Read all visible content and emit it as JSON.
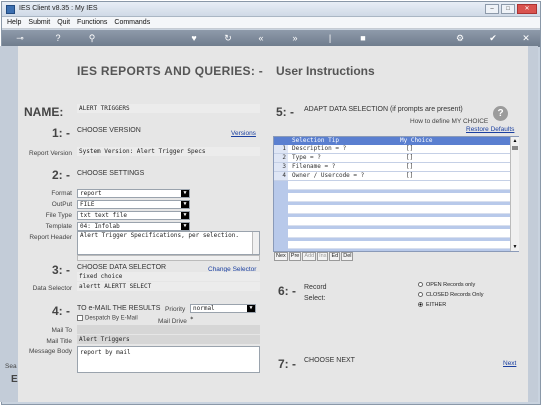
{
  "window": {
    "title": "IES Client v8.35 : My IES"
  },
  "menu": [
    "Help",
    "Submit",
    "Quit",
    "Functions",
    "Commands"
  ],
  "header": {
    "title": "IES REPORTS AND QUERIES:  -",
    "subtitle": "User Instructions"
  },
  "name": {
    "label": "NAME:",
    "value": "ALERT TRIGGERS"
  },
  "step1": {
    "number": "1: -",
    "title": "CHOOSE VERSION",
    "link": "Versions",
    "report_version_label": "Report Version",
    "report_version_value": "System Version: Alert Trigger Specs"
  },
  "step2": {
    "number": "2: -",
    "title": "CHOOSE SETTINGS",
    "format_label": "Format",
    "format_value": "report",
    "output_label": "OutPut",
    "output_value": "FILE",
    "filetype_label": "File Type",
    "filetype_value": "txt text file",
    "template_label": "Template",
    "template_value": "04: Infolab",
    "report_header_label": "Report Header",
    "report_header_value": "Alert Trigger Specifications, per selection."
  },
  "step3": {
    "number": "3: -",
    "title": "CHOOSE DATA SELECTOR",
    "link": "Change Selector",
    "line1": "fixed choice",
    "data_selector_label": "Data Selector",
    "data_selector_value": "alertt ALERTT SELECT"
  },
  "step4": {
    "number": "4: -",
    "title": "TO e-MAIL THE RESULTS",
    "priority_label": "Priority",
    "priority_value": "normal",
    "despatch_label": "Despatch By E-Mail",
    "mail_drive_label": "Mail Drive",
    "mail_drive_value": "*",
    "mail_to_label": "Mail To",
    "mail_title_label": "Mail Title",
    "mail_title_value": "Alert Triggers",
    "message_body_label": "Message Body",
    "message_body_value": "report by mail"
  },
  "step5": {
    "number": "5: -",
    "title": "ADAPT DATA SELECTION (if prompts are present)",
    "help_text": "How to define MY CHOICE",
    "restore_link": "Restore Defaults",
    "col_tip": "Selection Tip",
    "col_choice": "My Choice",
    "rows": [
      {
        "num": "1",
        "tip": "Description = ?",
        "choice": "[]"
      },
      {
        "num": "2",
        "tip": "Type = ?",
        "choice": "[]"
      },
      {
        "num": "3",
        "tip": "Filename = ?",
        "choice": "[]"
      },
      {
        "num": "4",
        "tip": "Owner / Usercode = ?",
        "choice": "[]"
      }
    ],
    "grid_buttons": [
      "Nex",
      "Pre",
      "Add",
      "Ins",
      "Ed",
      "Del"
    ]
  },
  "step6": {
    "number": "6: -",
    "title": "Record",
    "select_label": "Select:",
    "options": [
      "OPEN Records only",
      "CLOSED Records Only",
      "EITHER"
    ],
    "selected": "EITHER"
  },
  "step7": {
    "number": "7: -",
    "title": "CHOOSE NEXT",
    "link": "Next"
  },
  "left_fragment": {
    "text1": "Sea",
    "text2": "E"
  }
}
